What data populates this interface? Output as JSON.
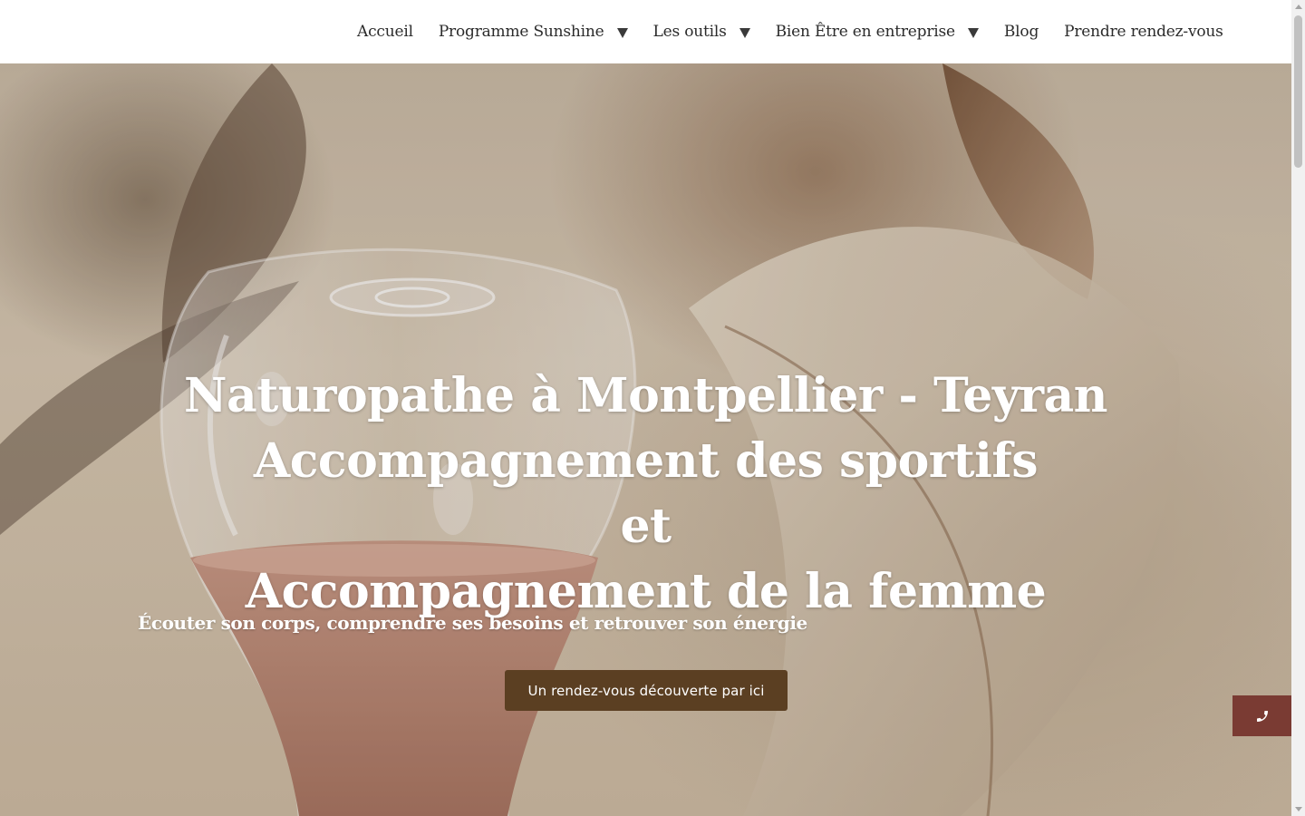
{
  "nav": {
    "items": [
      {
        "label": "Accueil",
        "dropdown": false
      },
      {
        "label": "Programme Sunshine",
        "dropdown": true
      },
      {
        "label": "Les outils",
        "dropdown": true
      },
      {
        "label": "Bien Être en entreprise",
        "dropdown": true
      },
      {
        "label": "Blog",
        "dropdown": false
      },
      {
        "label": "Prendre rendez-vous",
        "dropdown": false
      }
    ]
  },
  "hero": {
    "title_lines": [
      "Naturopathe à Montpellier - Teyran",
      "Accompagnement des sportifs",
      "et",
      "Accompagnement de la femme"
    ],
    "subtitle": "Écouter son corps, comprendre ses besoins et retrouver son énergie",
    "cta_label": "Un rendez-vous découverte par ici"
  },
  "floating": {
    "phone_icon": "phone-icon"
  },
  "colors": {
    "cta_background": "#5b3f22",
    "phone_button_background": "#7a3b33",
    "nav_text": "#2b2b2b",
    "hero_text": "#ffffff"
  }
}
